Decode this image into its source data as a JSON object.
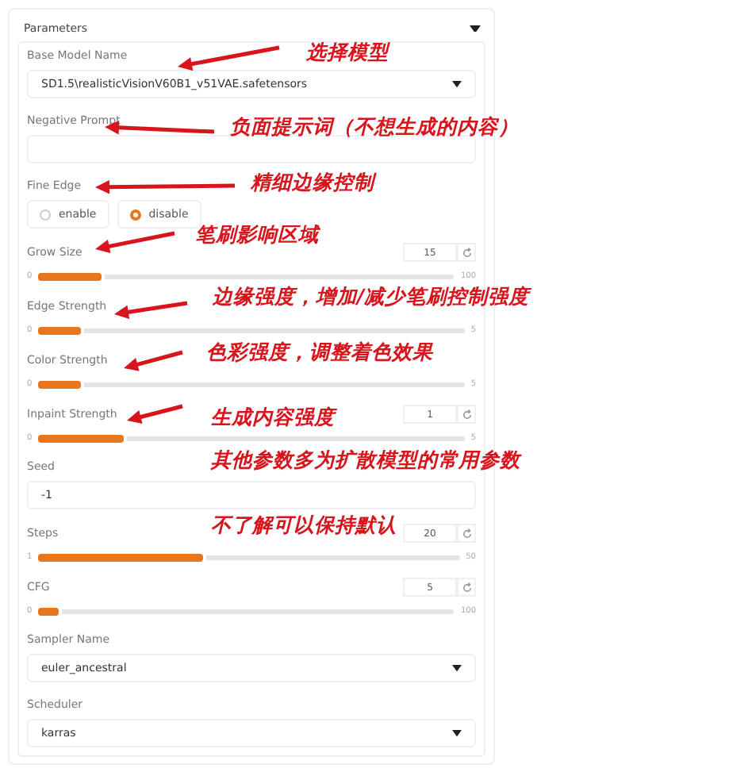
{
  "panel": {
    "title": "Parameters",
    "expanded": true
  },
  "fields": [
    {
      "kind": "select",
      "label": "Base Model Name",
      "value": "SD1.5\\realisticVisionV60B1_v51VAE.safetensors"
    },
    {
      "kind": "textarea",
      "label": "Negative Prompt"
    },
    {
      "kind": "radio",
      "label": "Fine Edge",
      "options": [
        {
          "label": "enable",
          "selected": false
        },
        {
          "label": "disable",
          "selected": true
        }
      ]
    },
    {
      "kind": "slider",
      "label": "Grow Size",
      "value": "15",
      "min": "0",
      "max": "100",
      "level": 0.15
    },
    {
      "kind": "slider",
      "label": "Edge Strength",
      "min": "0",
      "max": "5",
      "level": 0.1
    },
    {
      "kind": "slider",
      "label": "Color Strength",
      "min": "0",
      "max": "5",
      "level": 0.1
    },
    {
      "kind": "slider",
      "label": "Inpaint Strength",
      "value": "1",
      "min": "0",
      "max": "5",
      "level": 0.2
    },
    {
      "kind": "text",
      "label": "Seed",
      "value": "-1"
    },
    {
      "kind": "slider",
      "label": "Steps",
      "value": "20",
      "min": "1",
      "max": "50",
      "level": 0.39
    },
    {
      "kind": "slider",
      "label": "CFG",
      "value": "5",
      "min": "0",
      "max": "100",
      "level": 0.05
    },
    {
      "kind": "select",
      "label": "Sampler Name",
      "value": "euler_ancestral"
    },
    {
      "kind": "select",
      "label": "Scheduler",
      "value": "karras"
    }
  ],
  "annotations": [
    {
      "lines": [
        "选择模型"
      ]
    },
    {
      "lines": [
        "负面提示词（不想生成的内容）"
      ]
    },
    {
      "lines": [
        "精细边缘控制"
      ]
    },
    {
      "lines": [
        "笔刷影响区域"
      ]
    },
    {
      "lines": [
        "边缘强度，增加/减少笔刷控制强度"
      ]
    },
    {
      "lines": [
        "色彩强度，调整着色效果"
      ]
    },
    {
      "lines": [
        "生成内容强度"
      ]
    },
    {
      "lines": [
        "其他参数多为扩散模型的常用参数",
        "不了解可以保持默认"
      ]
    }
  ]
}
